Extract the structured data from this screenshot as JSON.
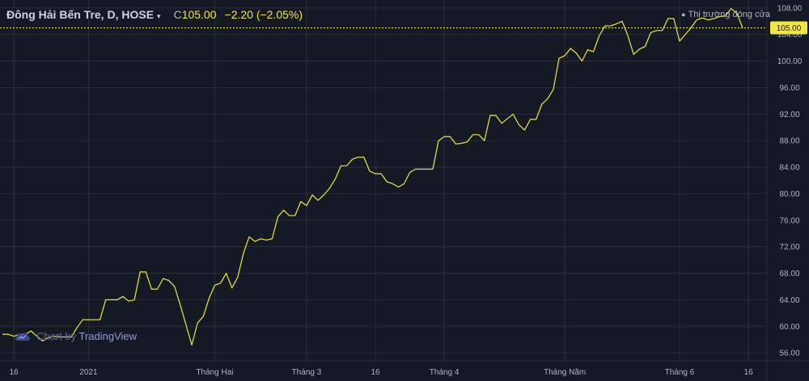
{
  "header": {
    "symbol": "Đông Hải Bến Tre, D, HOSE",
    "caret": "▾",
    "close_label": "C",
    "close_value": "105.00",
    "change": "−2.20 (−2.05%)"
  },
  "market_status": "Thị trường đóng cửa",
  "price_label": "105.00",
  "watermark": {
    "prefix": "Chart by ",
    "brand": "TradingView",
    "icon": "tradingview-cloud-icon"
  },
  "colors": {
    "background": "#151924",
    "grid": "#2a2e39",
    "line": "#f0e64c",
    "axis_text": "#b2b5be",
    "price_label_bg": "#f0e64c",
    "price_label_text": "#151924"
  },
  "chart_data": {
    "type": "line",
    "title": "Đông Hải Bến Tre, D, HOSE",
    "xlabel": "",
    "ylabel": "",
    "ylim": [
      54.8,
      109.2
    ],
    "y_ticks": [
      56,
      60,
      64,
      68,
      72,
      76,
      80,
      84,
      88,
      92,
      96,
      100,
      104,
      108
    ],
    "x_ticks": [
      {
        "label": "16",
        "index": 2
      },
      {
        "label": "2021",
        "index": 15
      },
      {
        "label": "Tháng Hai",
        "index": 37
      },
      {
        "label": "Tháng 3",
        "index": 53
      },
      {
        "label": "16",
        "index": 65
      },
      {
        "label": "Tháng 4",
        "index": 77
      },
      {
        "label": "Tháng Năm",
        "index": 98
      },
      {
        "label": "Tháng 6",
        "index": 118
      },
      {
        "label": "16",
        "index": 130
      }
    ],
    "grid": true,
    "last_value": 105.0,
    "series": [
      {
        "values": [
          58.8,
          58.8,
          58.5,
          58.8,
          58.8,
          59.3,
          58.5,
          57.8,
          58.3,
          58.5,
          58.4,
          58.4,
          58.4,
          59.8,
          61.0,
          61.0,
          61.0,
          61.0,
          64.0,
          64.0,
          64.0,
          64.5,
          63.8,
          64.0,
          68.2,
          68.2,
          65.6,
          65.6,
          67.2,
          66.9,
          66.0,
          63.2,
          60.2,
          57.2,
          60.5,
          61.5,
          64.2,
          66.2,
          66.5,
          68.0,
          65.8,
          67.4,
          71.0,
          73.5,
          72.8,
          73.2,
          73.0,
          73.2,
          76.5,
          77.5,
          76.7,
          76.7,
          78.8,
          78.2,
          79.8,
          79.0,
          79.8,
          80.8,
          82.2,
          84.2,
          84.2,
          85.2,
          85.5,
          85.5,
          83.4,
          83.0,
          83.0,
          81.8,
          81.5,
          81.0,
          81.5,
          83.2,
          83.7,
          83.7,
          83.7,
          83.7,
          88.0,
          88.6,
          88.6,
          87.5,
          87.6,
          87.8,
          88.9,
          88.9,
          88.0,
          91.8,
          91.8,
          90.6,
          91.3,
          92.0,
          90.4,
          89.6,
          91.2,
          91.2,
          93.5,
          94.3,
          95.7,
          100.4,
          100.8,
          101.9,
          101.2,
          100.0,
          101.7,
          101.4,
          103.8,
          105.3,
          105.3,
          105.6,
          106.0,
          103.8,
          101.0,
          101.8,
          102.2,
          104.3,
          104.6,
          104.6,
          106.4,
          106.4,
          103.0,
          104.0,
          105.0,
          106.2,
          106.5,
          106.2,
          106.4,
          106.7,
          106.8,
          107.9,
          107.2,
          105.0
        ]
      }
    ]
  }
}
